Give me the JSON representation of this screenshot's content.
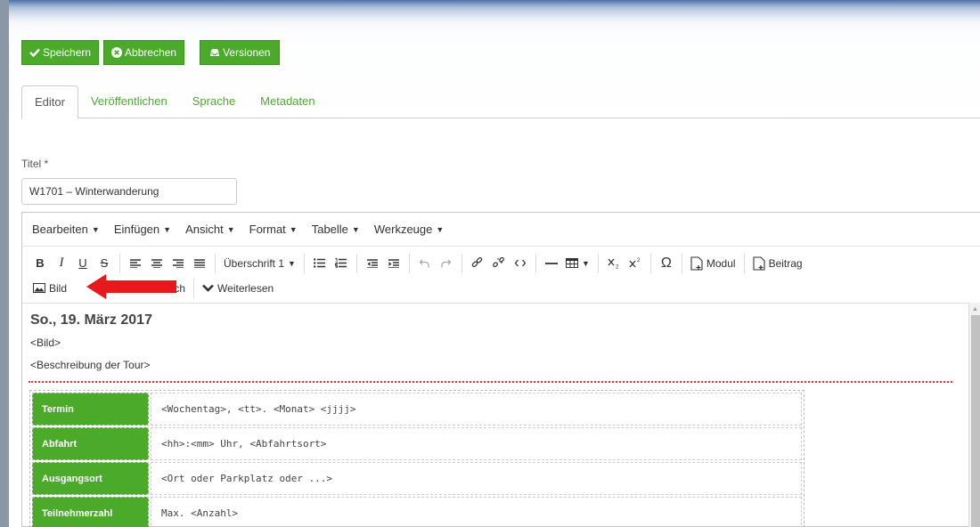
{
  "actions": {
    "save": "Speichern",
    "cancel": "Abbrechen",
    "versions": "Versionen"
  },
  "tabs": [
    {
      "label": "Editor",
      "active": true
    },
    {
      "label": "Veröffentlichen",
      "active": false
    },
    {
      "label": "Sprache",
      "active": false
    },
    {
      "label": "Metadaten",
      "active": false
    }
  ],
  "title_field": {
    "label": "Titel *",
    "value": "W1701 – Winterwanderung"
  },
  "menubar": [
    "Bearbeiten",
    "Einfügen",
    "Ansicht",
    "Format",
    "Tabelle",
    "Werkzeuge"
  ],
  "toolbar": {
    "bold": "B",
    "italic": "I",
    "underline": "U",
    "strike": "S",
    "heading_select": "Überschrift 1",
    "module": "Modul",
    "article": "Beitrag",
    "image": "Bild",
    "pagebreak_partial": "bruch",
    "readmore": "Weiterlesen"
  },
  "content": {
    "date_heading": "So., 19. März 2017",
    "image_placeholder": "<Bild>",
    "description_placeholder": "<Beschreibung der Tour>",
    "rows": [
      {
        "key": "Termin",
        "value": "<Wochentag>, <tt>. <Monat> <jjjj>"
      },
      {
        "key": "Abfahrt",
        "value": "<hh>:<mm> Uhr, <Abfahrtsort>"
      },
      {
        "key": "Ausgangsort",
        "value": "<Ort oder Parkplatz oder ...>"
      },
      {
        "key": "Teilnehmerzahl",
        "value": "Max. <Anzahl>"
      }
    ]
  },
  "colors": {
    "accent": "#4caa2b",
    "arrow": "#e8191c",
    "readmore_line": "#e03333"
  }
}
